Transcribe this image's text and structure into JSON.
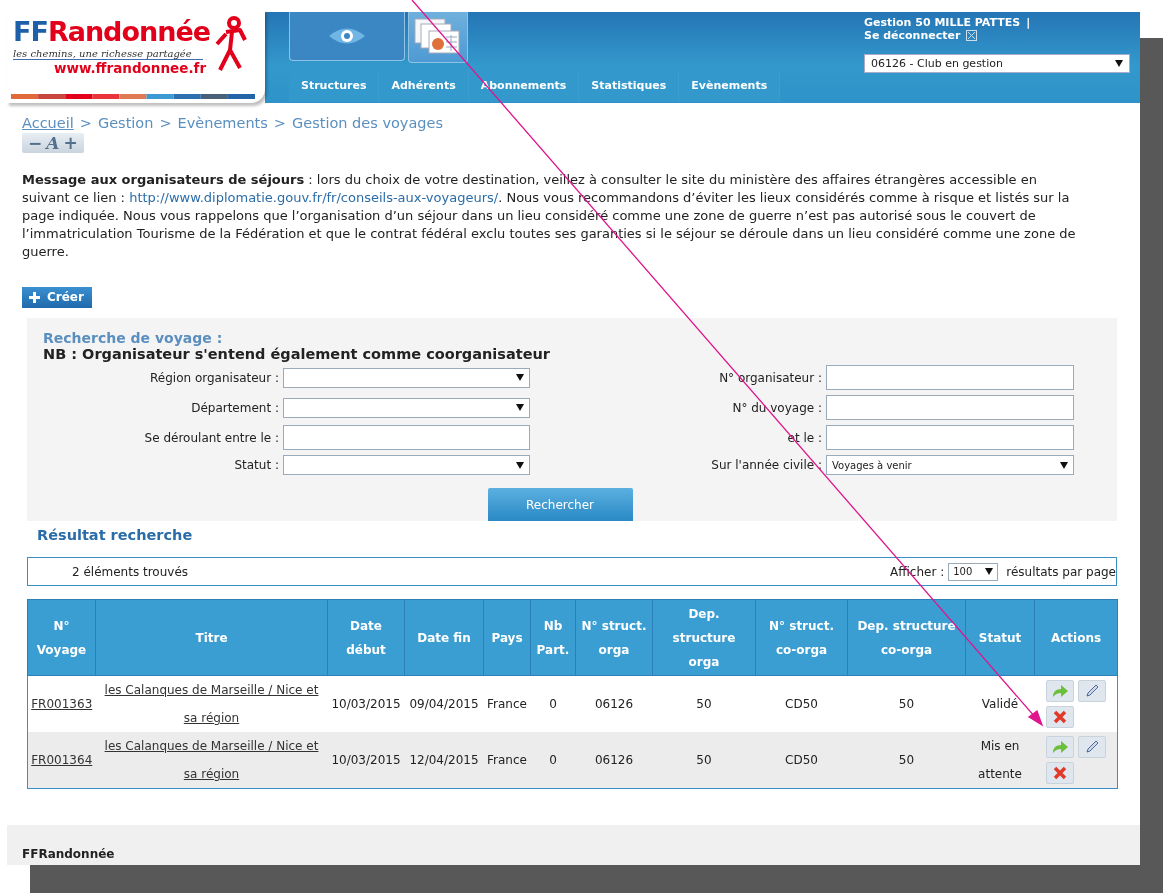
{
  "logo": {
    "prefix": "FF",
    "name": "Randonnée",
    "tagline": "les chemins, une richesse partagée",
    "url": "www.ffrandonnee.fr"
  },
  "icon_tabs": [
    {
      "kind": "eye",
      "selected": false
    },
    {
      "kind": "documents",
      "selected": true
    }
  ],
  "menu": [
    "Structures",
    "Adhérents",
    "Abonnements",
    "Statistiques",
    "Evènements"
  ],
  "user": {
    "name": "Gestion 50 MILLE PATTES",
    "separator": "|",
    "logout": "Se déconnecter",
    "structure": "06126 - Club en gestion"
  },
  "breadcrumb": [
    {
      "label": "Accueil",
      "link": true
    },
    {
      "label": "Gestion",
      "link": false
    },
    {
      "label": "Evènements",
      "link": false
    },
    {
      "label": "Gestion des voyages",
      "link": false
    }
  ],
  "breadcrumb_separator": ">",
  "font_size_controls": [
    "−",
    "A",
    "+"
  ],
  "message": {
    "lead": "Message aux organisateurs de séjours",
    "before": " : lors du choix de votre destination, veillez à consulter le site du ministère des affaires étrangères accessible en suivant ce lien : ",
    "link": "http://www.diplomatie.gouv.fr/fr/conseils-aux-voyageurs/",
    "after": ". Nous vous recommandons d’éviter les lieux considérés comme à risque et listés sur la page indiquée. Nous vous rappelons que l’organisation d’un séjour dans un lieu considéré comme une zone de guerre n’est pas autorisé sous le couvert de l’immatriculation Tourisme de la Fédération et que le contrat fédéral exclu toutes ses garanties si le séjour se déroule dans un lieu considéré comme une zone de guerre."
  },
  "create_button": "Créer",
  "search": {
    "title": "Recherche de voyage :",
    "note": "NB : Organisateur s'entend également comme coorganisateur",
    "fields": [
      {
        "label": "Région organisateur :",
        "kind": "select"
      },
      {
        "label": "N° organisateur :",
        "kind": "text"
      },
      {
        "label": "Département :",
        "kind": "select"
      },
      {
        "label": "N° du voyage :",
        "kind": "text"
      },
      {
        "label": "Se déroulant entre le :",
        "kind": "text"
      },
      {
        "label": "et le :",
        "kind": "text"
      },
      {
        "label": "Statut :",
        "kind": "select"
      },
      {
        "label": "Sur l'année civile :",
        "kind": "select",
        "value": "Voyages à venir"
      }
    ],
    "button": "Rechercher"
  },
  "results": {
    "title": "Résultat recherche",
    "count": "2 éléments trouvés",
    "show_label": "Afficher :",
    "page_size": "100",
    "per_page": "résultats par page"
  },
  "table": {
    "columns": [
      "N° Voyage",
      "Titre",
      "Date début",
      "Date fin",
      "Pays",
      "Nb Part.",
      "N° struct. orga",
      "Dep. structure orga",
      "N° struct. co-orga",
      "Dep. structure co-orga",
      "Statut",
      "Actions"
    ],
    "rows": [
      {
        "cells": [
          "FR001363",
          "les Calanques de Marseille / Nice et sa région",
          "10/03/2015",
          "09/04/2015",
          "France",
          "0",
          "06126",
          "50",
          "CD50",
          "50",
          "Validé"
        ]
      },
      {
        "cells": [
          "FR001364",
          "les Calanques de Marseille / Nice et sa région",
          "10/03/2015",
          "12/04/2015",
          "France",
          "0",
          "06126",
          "50",
          "CD50",
          "50",
          "Mis en attente"
        ]
      }
    ]
  },
  "footer": "FFRandonnée"
}
